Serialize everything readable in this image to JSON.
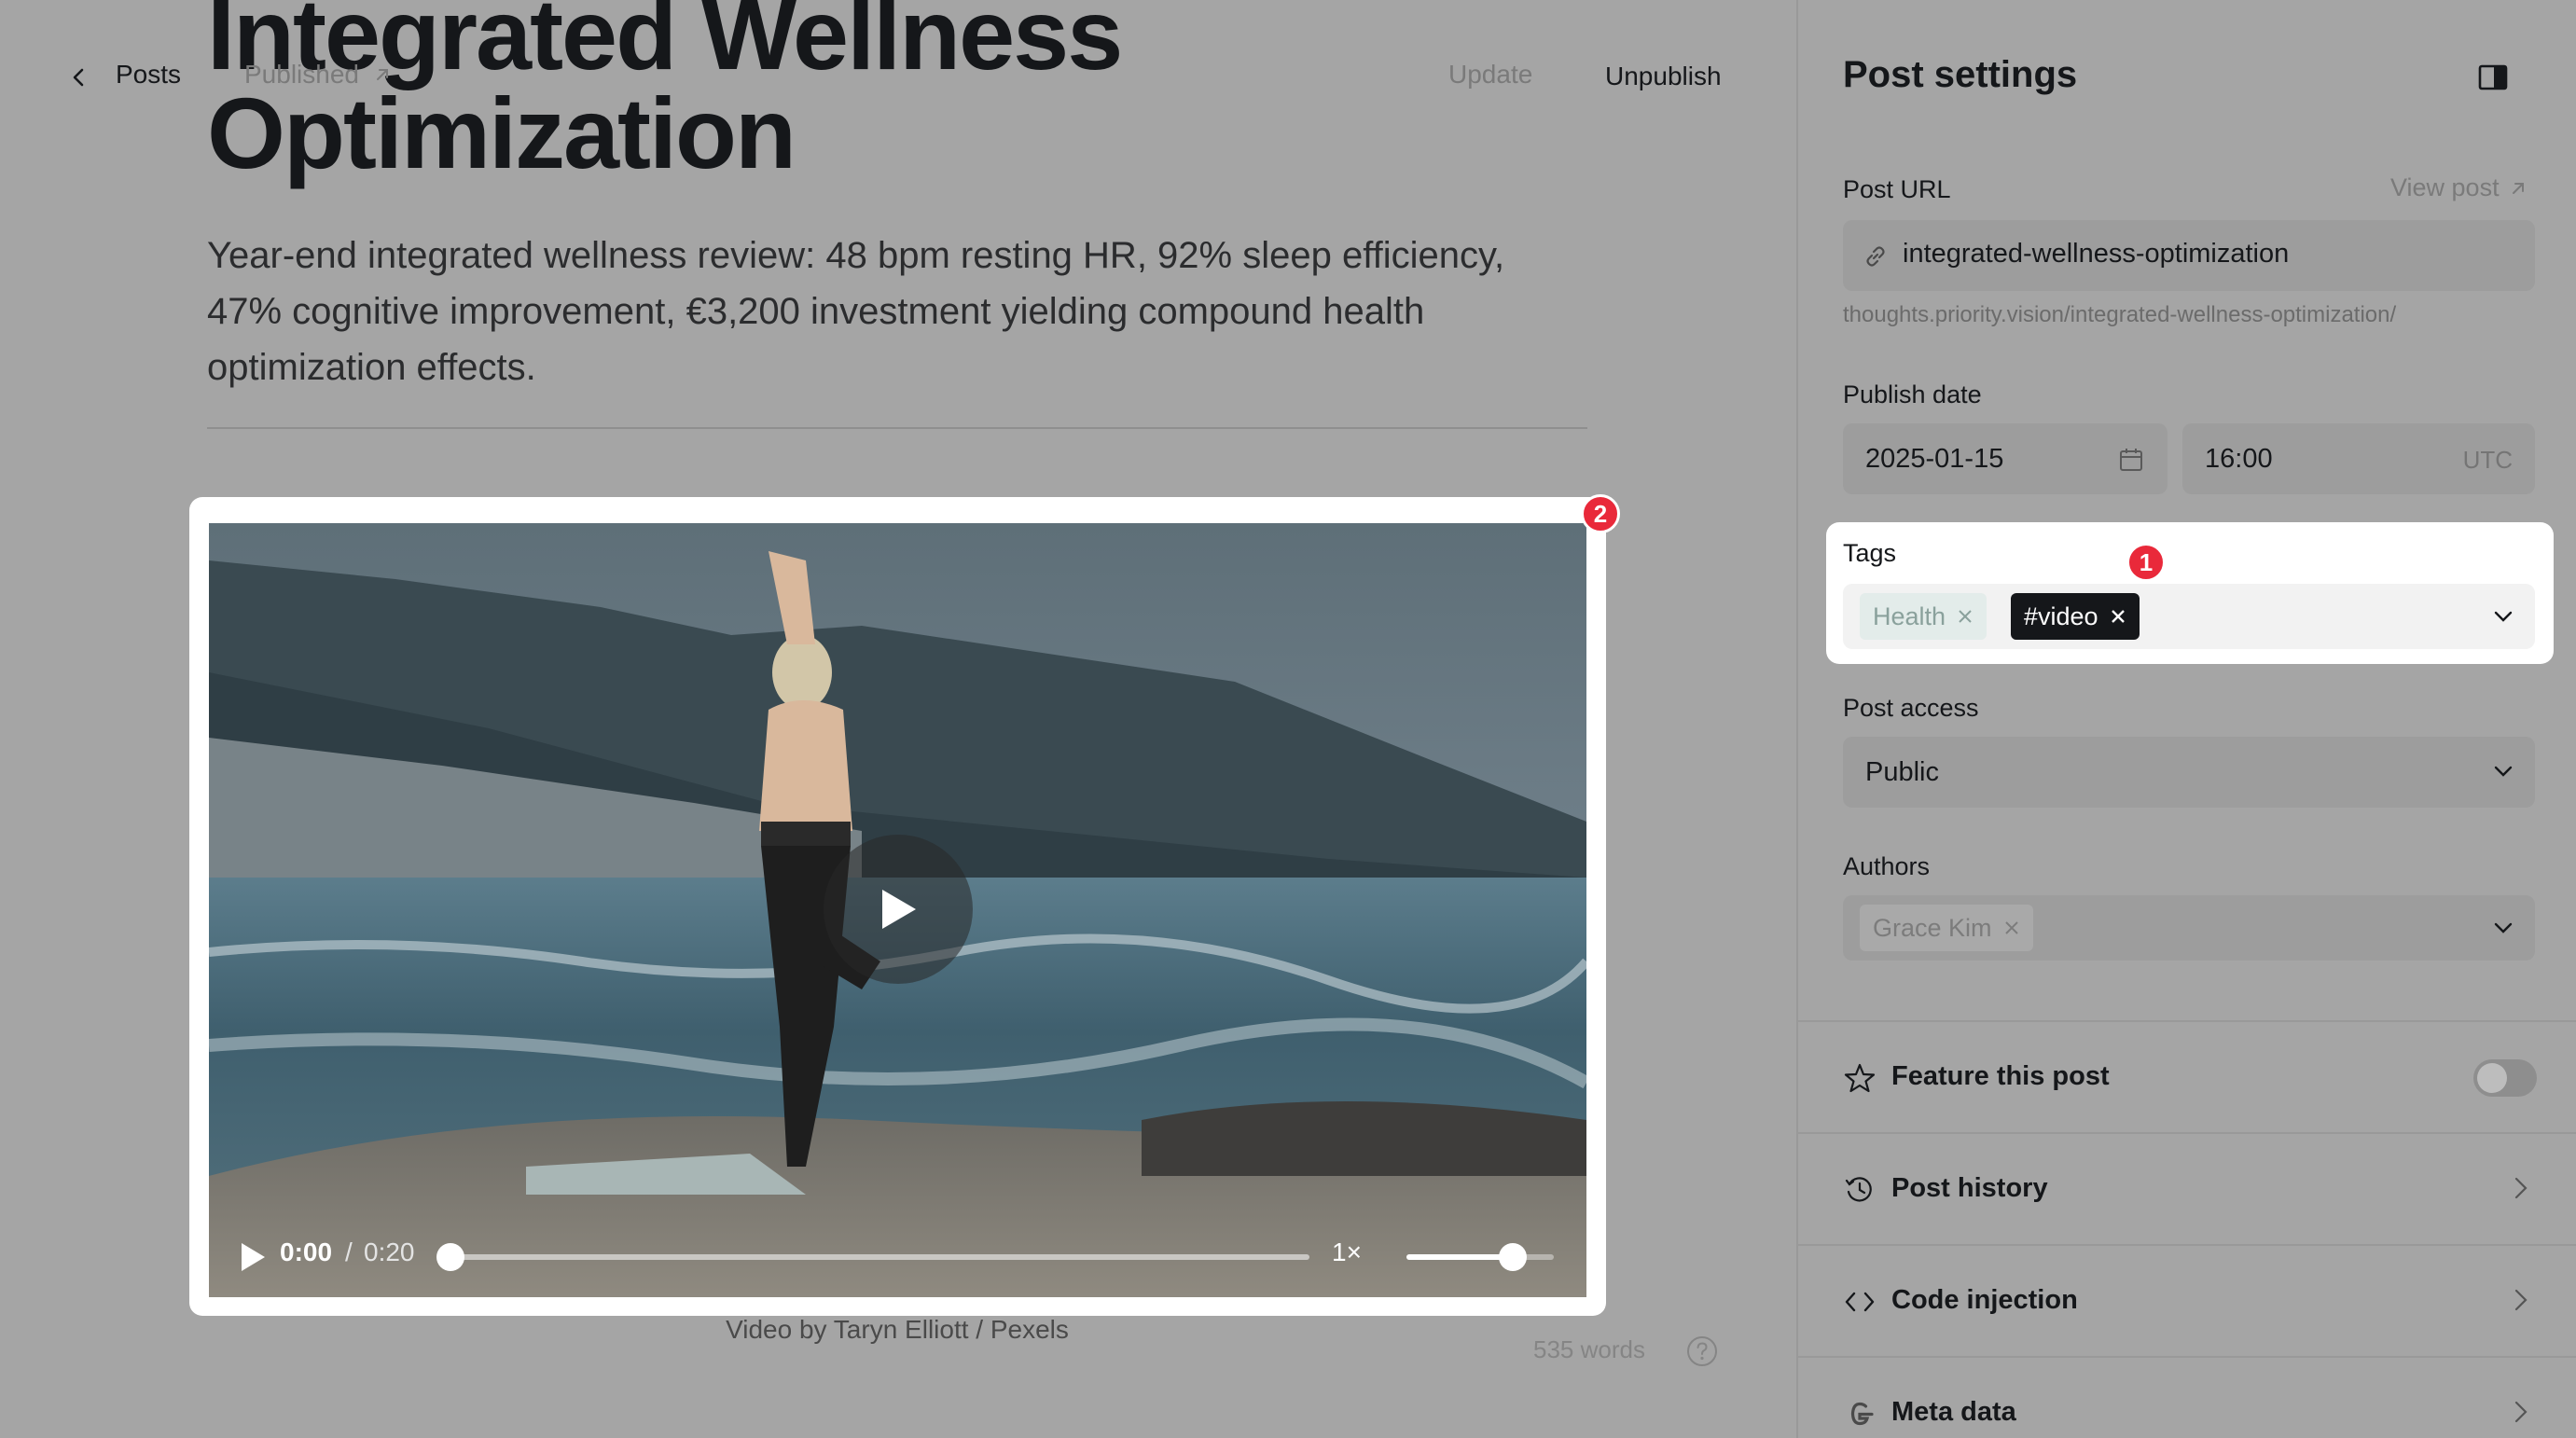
{
  "topbar": {
    "back_label": "Posts",
    "status_label": "Published",
    "update_label": "Update",
    "unpublish_label": "Unpublish"
  },
  "post": {
    "title": "Integrated Wellness Optimization",
    "excerpt": "Year-end integrated wellness review: 48 bpm resting HR, 92% sleep efficiency, 47% cognitive improvement, €3,200 investment yielding compound health optimization effects.",
    "video_caption": "Video by Taryn Elliott / Pexels",
    "word_count": "535 words"
  },
  "video_player": {
    "current_time": "0:00",
    "separator": "/",
    "duration": "0:20",
    "playback_speed": "1×",
    "progress_fraction": 0.0,
    "volume_fraction": 0.72
  },
  "badges": {
    "tags_badge": "1",
    "video_badge": "2"
  },
  "settings": {
    "title": "Post settings",
    "post_url_label": "Post URL",
    "view_post_label": "View post",
    "post_url_value": "integrated-wellness-optimization",
    "post_url_hint": "thoughts.priority.vision/integrated-wellness-optimization/",
    "publish_date_label": "Publish date",
    "publish_date_value": "2025-01-15",
    "publish_time_value": "16:00",
    "timezone": "UTC",
    "tags_label": "Tags",
    "tags": [
      "Health",
      "#video"
    ],
    "post_access_label": "Post access",
    "post_access_value": "Public",
    "authors_label": "Authors",
    "authors": [
      "Grace Kim"
    ],
    "feature_label": "Feature this post",
    "feature_enabled": false,
    "history_label": "Post history",
    "code_injection_label": "Code injection",
    "meta_data_label": "Meta data"
  },
  "colors": {
    "overlay_gray": "#a5a5a5",
    "badge_red": "#e9293a",
    "highlight_white": "#ffffff",
    "tag_selected_bg": "#15171a"
  }
}
